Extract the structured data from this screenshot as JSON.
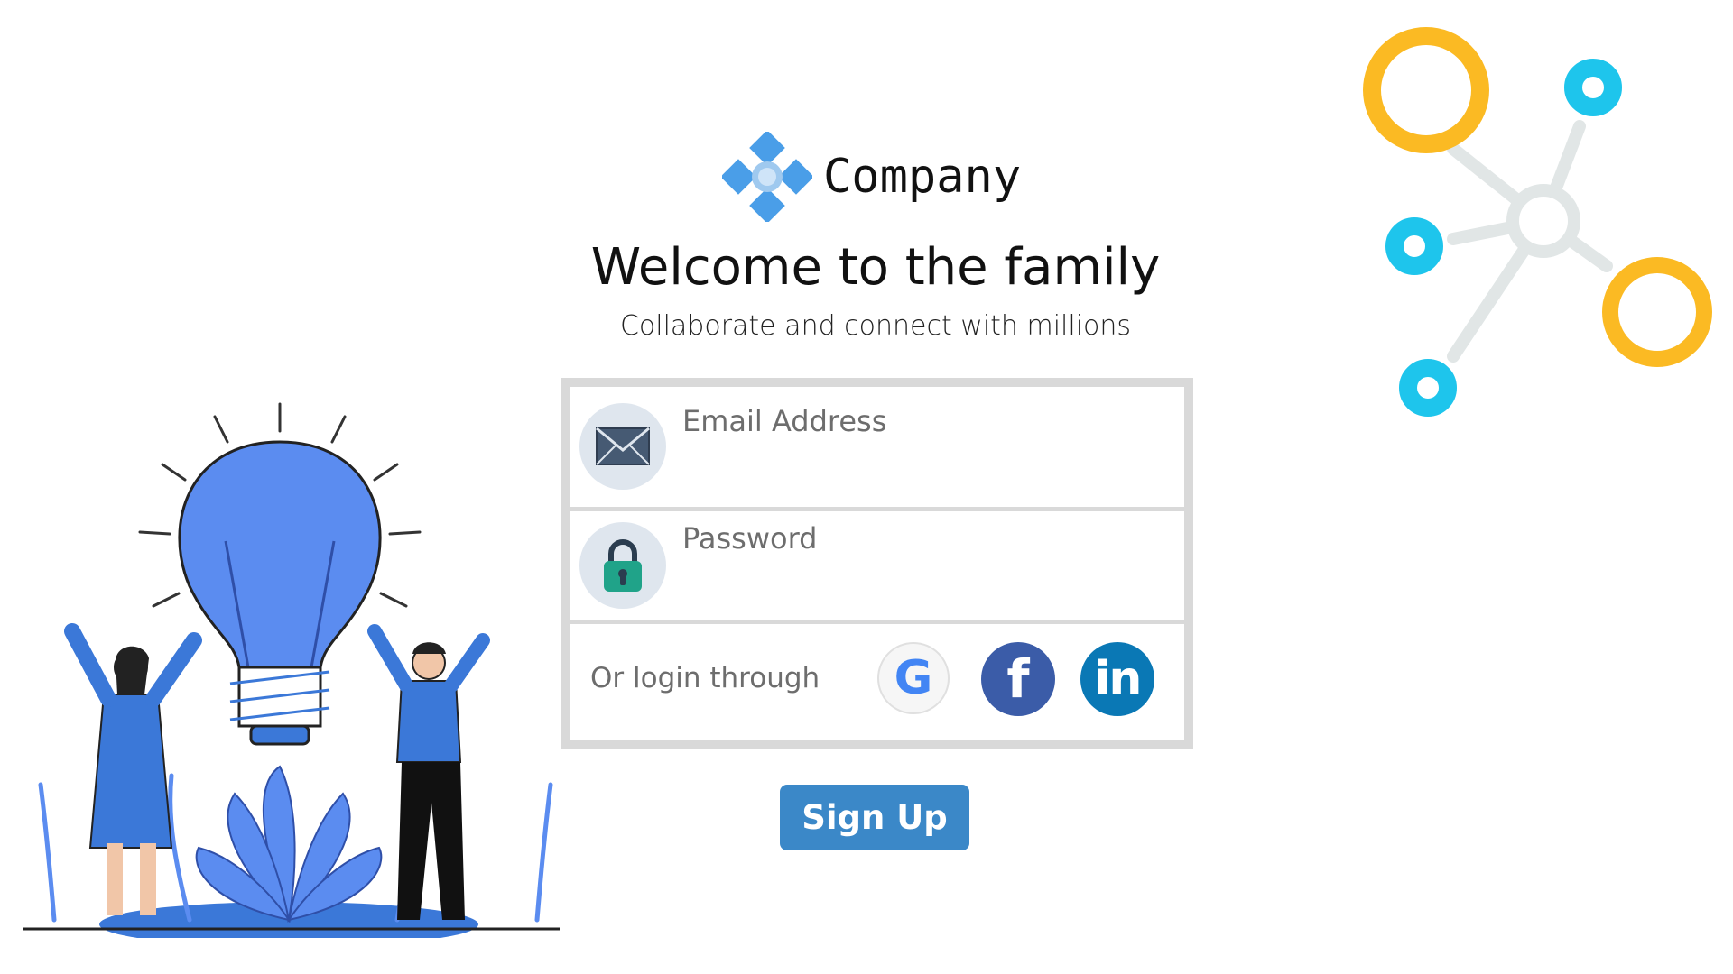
{
  "brand": {
    "name": "Company",
    "logo": "diamond-flower-logo"
  },
  "welcome": {
    "title": "Welcome to the family",
    "subtitle": "Collaborate and connect with millions"
  },
  "form": {
    "email": {
      "placeholder": "Email Address",
      "value": "",
      "icon": "envelope-icon"
    },
    "password": {
      "placeholder": "Password",
      "value": "",
      "icon": "lock-icon"
    },
    "social": {
      "label": "Or login through",
      "google": {
        "glyph": "G",
        "icon": "google-icon"
      },
      "facebook": {
        "glyph": "f",
        "icon": "facebook-icon"
      },
      "linkedin": {
        "glyph": "in",
        "icon": "linkedin-icon"
      }
    }
  },
  "signup_label": "Sign Up",
  "colors": {
    "accent": "#3b88c8",
    "logo_blue": "#4a9ee8",
    "facebook": "#3b5ca8",
    "linkedin": "#0a78b5",
    "network_yellow": "#fbba23",
    "network_cyan": "#1ec5ec",
    "network_gray": "#e1e6e6",
    "illustration_blue": "#3b78d8"
  }
}
